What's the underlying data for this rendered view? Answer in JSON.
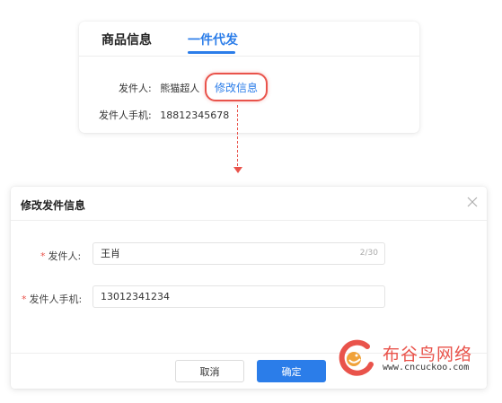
{
  "top_card": {
    "tabs": [
      {
        "label": "商品信息",
        "active": false
      },
      {
        "label": "一件代发",
        "active": true
      }
    ],
    "sender_label": "发件人:",
    "sender_value": "熊猫超人",
    "phone_label": "发件人手机:",
    "phone_value": "18812345678",
    "edit_button": "修改信息"
  },
  "dialog": {
    "title": "修改发件信息",
    "close_icon": "close-icon",
    "fields": [
      {
        "required_mark": "*",
        "label": "发件人:",
        "value": "王肖",
        "counter": "2/30"
      },
      {
        "required_mark": "*",
        "label": "发件人手机:",
        "value": "13012341234"
      }
    ],
    "cancel_label": "取消",
    "confirm_label": "确定"
  },
  "watermark": {
    "name": "布谷鸟网络",
    "url": "www.cncuckoo.com"
  },
  "colors": {
    "accent": "#2b7de9",
    "highlight": "#e9534b"
  }
}
